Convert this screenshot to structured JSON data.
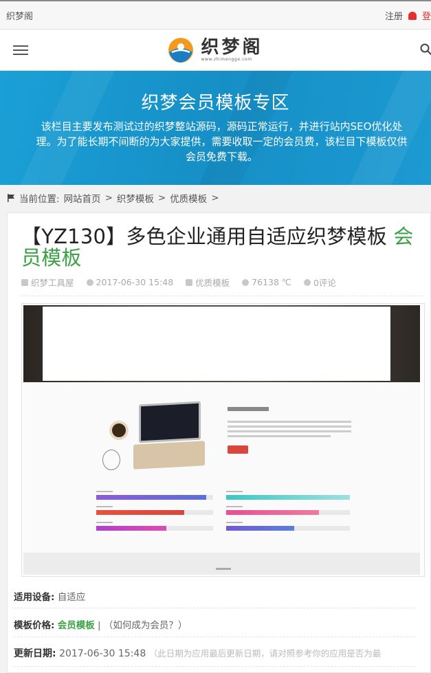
{
  "topbar": {
    "site_name": "织梦阁",
    "register": "注册",
    "login": "登"
  },
  "header": {
    "logo_text": "织梦阁",
    "logo_url": "www.zhimengge.com"
  },
  "banner": {
    "title": "织梦会员模板专区",
    "description": "该栏目主要发布测试过的织梦整站源码，源码正常运行，并进行站内SEO优化处理。为了能长期不间断的为大家提供，需要收取一定的会员费，该栏目下模板仅供会员免费下载。"
  },
  "breadcrumb": {
    "prefix": "当前位置:",
    "items": [
      "网站首页",
      "织梦模板",
      "优质模板"
    ],
    "sep": ">"
  },
  "article": {
    "title": "【YZ130】多色企业通用自适应织梦模板",
    "tag": "会员模板",
    "meta": {
      "author": "织梦工具屋",
      "date": "2017-06-30 15:48",
      "category": "优质模板",
      "views": "76138 ℃",
      "comments": "0评论"
    }
  },
  "details": {
    "device_label": "适用设备:",
    "device_value": "自适应",
    "price_label": "模板价格:",
    "price_value": "会员模板",
    "price_sep": "|",
    "price_link": "（如何成为会员？）",
    "date_label": "更新日期:",
    "date_value": "2017-06-30 15:48",
    "date_note": "（此日期为应用最后更新日期，请对照参考你的应用是否为最"
  },
  "colors": {
    "brand_blue": "#1c98cf",
    "accent_green": "#3aa244",
    "alert_red": "#e3312f"
  }
}
